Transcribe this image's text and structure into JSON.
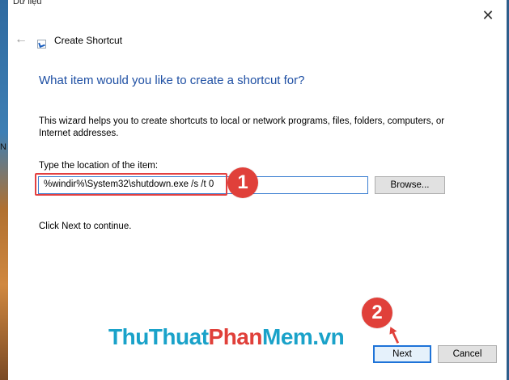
{
  "desktop": {
    "label_top": "Dữ liệu",
    "label_side": "N"
  },
  "window": {
    "title": "Create Shortcut",
    "heading": "What item would you like to create a shortcut for?",
    "description": "This wizard helps you to create shortcuts to local or network programs, files, folders, computers, or Internet addresses.",
    "location_label": "Type the location of the item:",
    "location_value": "%windir%\\System32\\shutdown.exe /s /t 0",
    "browse_label": "Browse...",
    "continue_text": "Click Next to continue.",
    "next_label": "Next",
    "cancel_label": "Cancel",
    "close_glyph": "✕",
    "back_glyph": "←"
  },
  "annotations": {
    "step1": "1",
    "step2": "2",
    "highlight_color": "#e34040"
  },
  "watermark": {
    "part1": "ThuThuat",
    "part2": "Phan",
    "part3": "Mem.vn"
  },
  "icons": {
    "back": "back-arrow-icon",
    "close": "close-icon",
    "shortcut": "shortcut-icon",
    "cursor": "mouse-cursor-icon"
  }
}
